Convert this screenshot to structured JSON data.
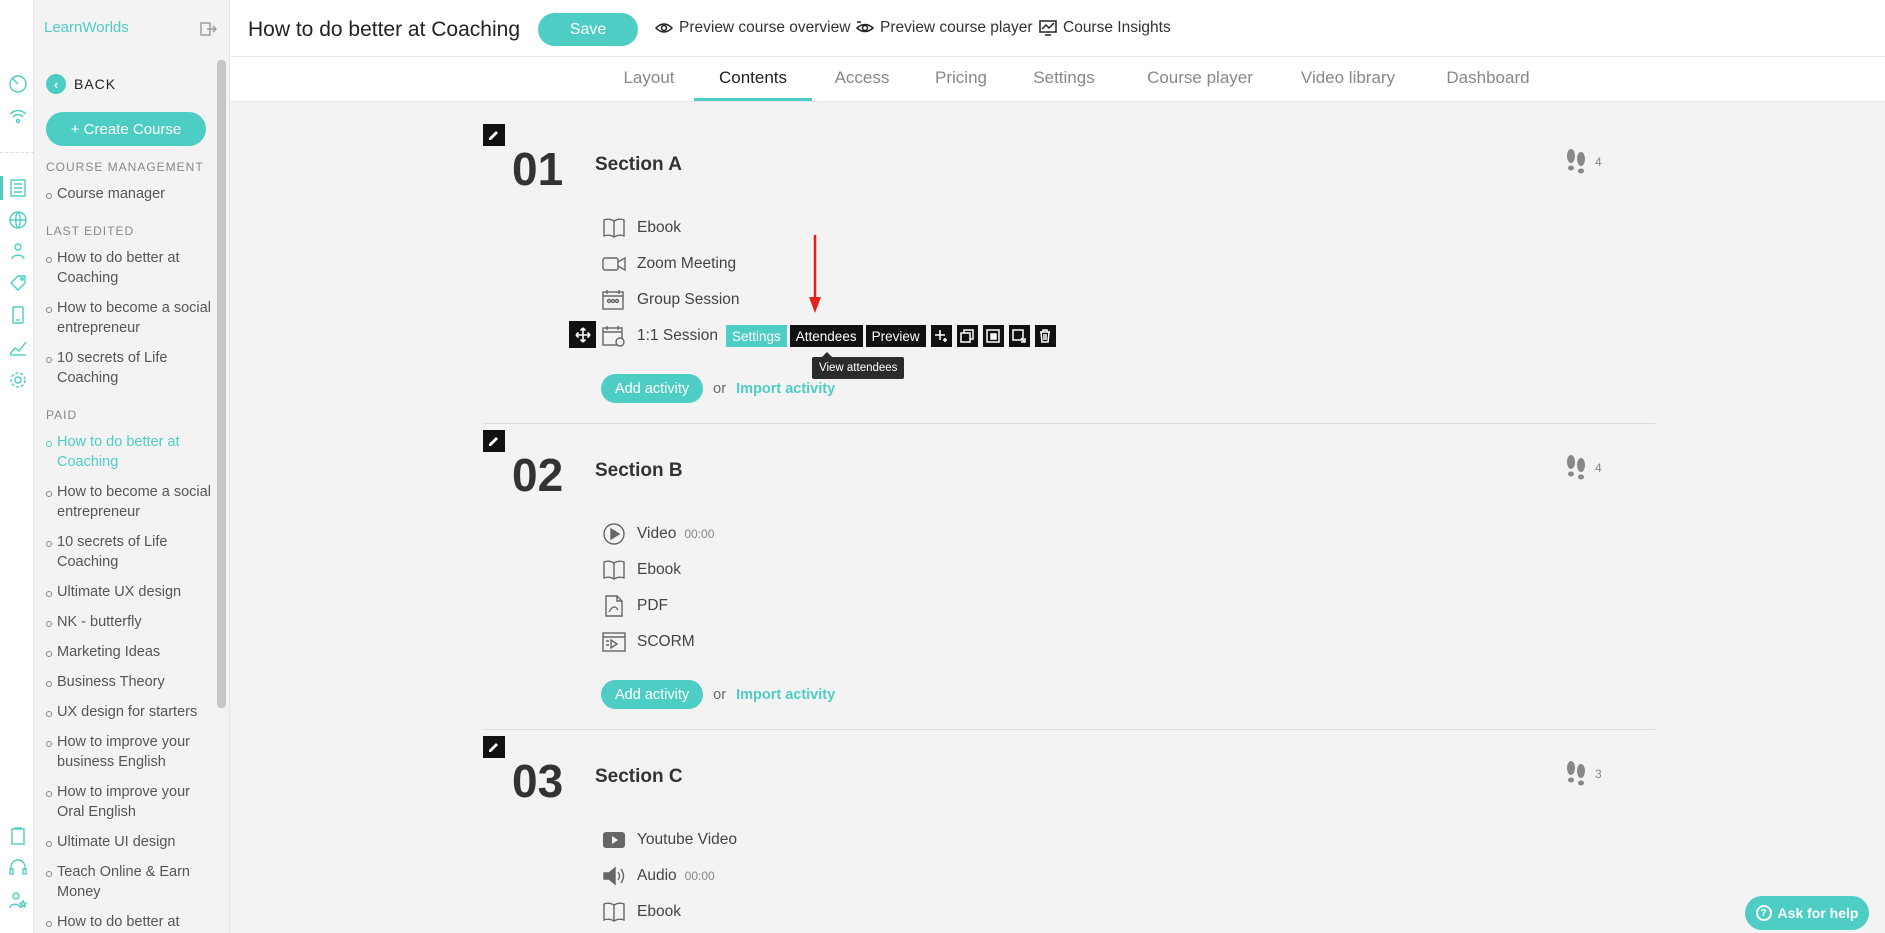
{
  "brand": {
    "name": "LearnWorlds",
    "logo_colors": [
      "#e74c3c",
      "#f39c12",
      "#2ecc71",
      "#3498db",
      "#9b59b6",
      "#1abc9c",
      "#e67e22",
      "#34495e",
      "#f1c40f"
    ]
  },
  "colors": {
    "accent": "#4ecdc4",
    "dark": "#111111",
    "arrow": "#e8201a"
  },
  "sidebar": {
    "back_label": "BACK",
    "create_label": "+ Create Course",
    "course_management_header": "COURSE MANAGEMENT",
    "course_manager": "Course manager",
    "last_edited_header": "LAST EDITED",
    "last_edited": [
      "How to do better at Coaching",
      "How to become a social entrepreneur",
      "10 secrets of Life Coaching"
    ],
    "paid_header": "PAID",
    "paid": [
      "How to do better at Coaching",
      "How to become a social entrepreneur",
      "10 secrets of Life Coaching",
      "Ultimate UX design",
      "NK - butterfly",
      "Marketing Ideas",
      "Business Theory",
      "UX design for starters",
      "How to improve your business English",
      "How to improve your Oral English",
      "Ultimate UI design",
      "Teach Online & Earn Money",
      "How to do better at Coaching"
    ]
  },
  "topbar": {
    "title": "How to do better at Coaching",
    "save_label": "Save",
    "preview_overview": "Preview course overview",
    "preview_player": "Preview course player",
    "insights": "Course Insights"
  },
  "tabs": [
    "Layout",
    "Contents",
    "Access",
    "Pricing",
    "Settings",
    "Course player",
    "Video library",
    "Dashboard"
  ],
  "active_tab": "Contents",
  "sections": [
    {
      "number": "01",
      "title": "Section A",
      "steps": "4",
      "activities": [
        {
          "icon": "ebook-icon",
          "label": "Ebook"
        },
        {
          "icon": "zoom-icon",
          "label": "Zoom Meeting"
        },
        {
          "icon": "group-session-icon",
          "label": "Group Session"
        },
        {
          "icon": "session-icon",
          "label": "1:1 Session"
        }
      ]
    },
    {
      "number": "02",
      "title": "Section B",
      "steps": "4",
      "activities": [
        {
          "icon": "video-icon",
          "label": "Video",
          "duration": "00:00"
        },
        {
          "icon": "ebook-icon",
          "label": "Ebook"
        },
        {
          "icon": "pdf-icon",
          "label": "PDF"
        },
        {
          "icon": "scorm-icon",
          "label": "SCORM"
        }
      ]
    },
    {
      "number": "03",
      "title": "Section C",
      "steps": "3",
      "activities": [
        {
          "icon": "youtube-icon",
          "label": "Youtube Video"
        },
        {
          "icon": "audio-icon",
          "label": "Audio",
          "duration": "00:00"
        },
        {
          "icon": "ebook-icon",
          "label": "Ebook"
        }
      ]
    }
  ],
  "activity_toolbar": {
    "settings": "Settings",
    "attendees": "Attendees",
    "preview": "Preview",
    "tooltip": "View attendees"
  },
  "add_activity_label": "Add activity",
  "or_label": "or",
  "import_activity_label": "Import activity",
  "help_label": "Ask for help"
}
